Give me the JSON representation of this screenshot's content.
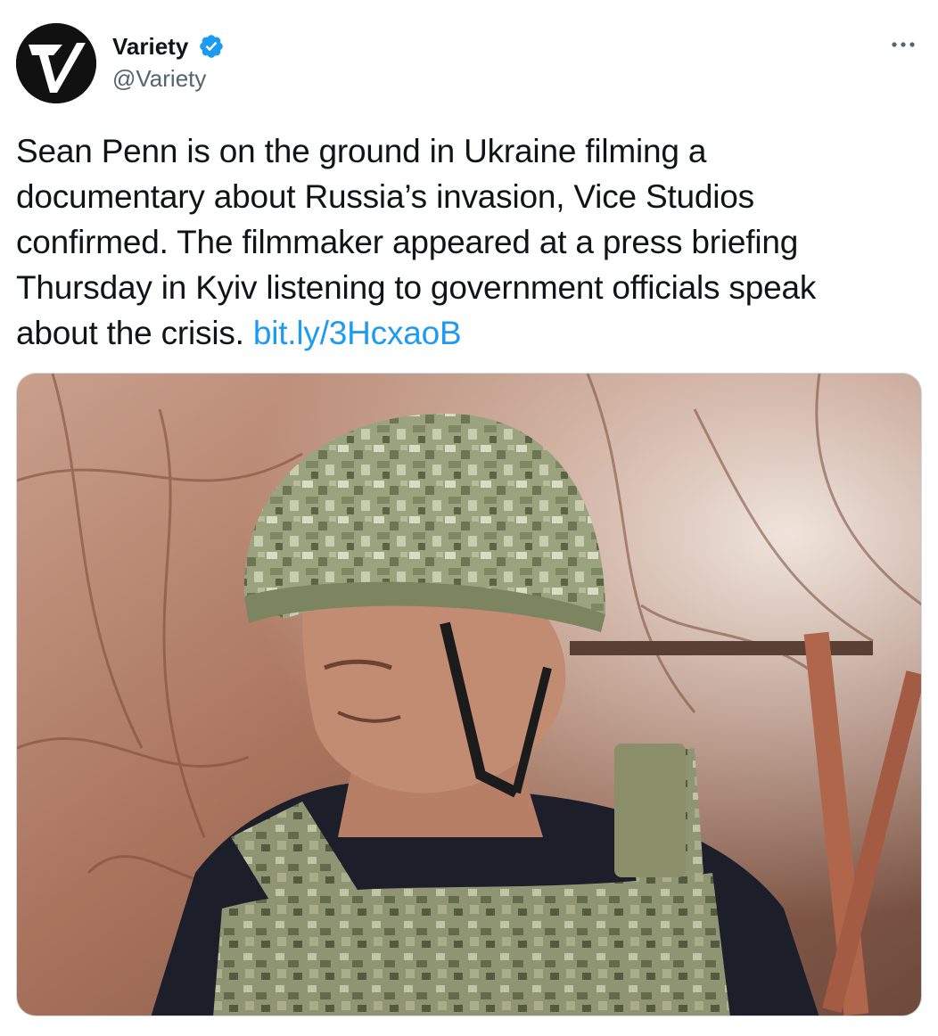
{
  "author": {
    "display_name": "Variety",
    "handle": "@Variety",
    "verified": true,
    "avatar_icon": "variety-v-logo-icon"
  },
  "tweet": {
    "text_lines": [
      "Sean Penn is on the ground in Ukraine filming a",
      "documentary about Russia’s invasion, Vice Studios",
      "confirmed. The filmmaker appeared at a press briefing",
      "Thursday in Kyiv listening to government officials speak",
      "about the crisis."
    ],
    "link_text": "bit.ly/3HcxaoB"
  },
  "media": {
    "image_icon": "man-in-camouflage-helmet-photo"
  },
  "menu": {
    "more_icon": "more-options-icon"
  },
  "colors": {
    "link": "#1d9bf0",
    "verified": "#1d9bf0",
    "secondary_text": "#536471",
    "primary_text": "#0f1419"
  }
}
